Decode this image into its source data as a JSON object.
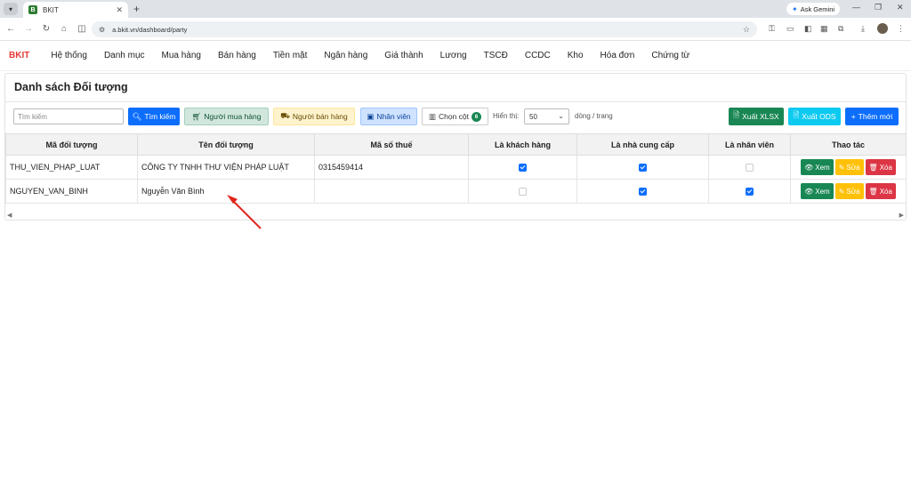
{
  "browser": {
    "tab_title": "BKIT",
    "tab_favicon": "B",
    "ask_gemini": "Ask Gemini",
    "url": "a.bkit.vn/dashboard/party"
  },
  "app": {
    "brand": "BKIT",
    "nav": [
      "Hệ thống",
      "Danh mục",
      "Mua hàng",
      "Bán hàng",
      "Tiền mặt",
      "Ngân hàng",
      "Giá thành",
      "Lương",
      "TSCĐ",
      "CCDC",
      "Kho",
      "Hóa đơn",
      "Chứng từ"
    ]
  },
  "page": {
    "title": "Danh sách Đối tượng",
    "search_placeholder": "Tìm kiếm",
    "btn_search": "Tìm kiếm",
    "btn_buyer": "Người mua hàng",
    "btn_seller": "Người bán hàng",
    "btn_employee": "Nhân viên",
    "btn_columns": "Chọn cột",
    "columns_count": "6",
    "show_label": "Hiển thị:",
    "page_size": "50",
    "per_page_label": "dòng / trang",
    "btn_export_xlsx": "Xuất XLSX",
    "btn_export_ods": "Xuất ODS",
    "btn_add": "Thêm mới"
  },
  "table": {
    "headers": [
      "Mã đối tượng",
      "Tên đối tượng",
      "Mã số thuế",
      "Là khách hàng",
      "Là nhà cung cấp",
      "Là nhân viên",
      "Thao tác"
    ],
    "rows": [
      {
        "code": "THU_VIEN_PHAP_LUAT",
        "name": "CÔNG TY TNHH THƯ VIỆN PHÁP LUẬT",
        "tax": "0315459414",
        "customer": true,
        "supplier": true,
        "employee": false
      },
      {
        "code": "NGUYEN_VAN_BINH",
        "name": "Nguyễn Văn Bình",
        "tax": "",
        "customer": false,
        "supplier": true,
        "employee": true
      }
    ],
    "action_view": "Xem",
    "action_edit": "Sửa",
    "action_delete": "Xóa"
  },
  "colors": {
    "primary": "#0d6efd",
    "success": "#198754",
    "warning": "#ffc107",
    "danger": "#dc3545",
    "brand": "#e53935"
  }
}
